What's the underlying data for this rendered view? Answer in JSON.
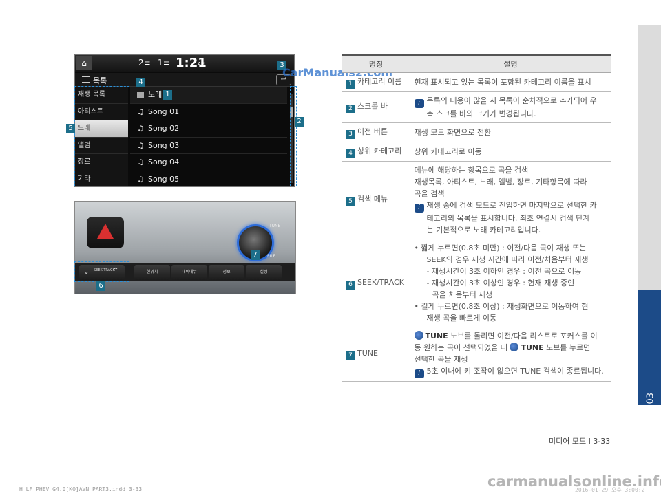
{
  "screen": {
    "stat_a": "2≡",
    "stat_b": "1≡",
    "clock": "1:21",
    "ampm": "AM",
    "title": "목록",
    "back": "↩",
    "categories": [
      "재생 목록",
      "아티스트",
      "노래",
      "앨범",
      "장르",
      "기타"
    ],
    "folder": "노래",
    "songs": [
      "Song 01",
      "Song 02",
      "Song 03",
      "Song 04",
      "Song 05"
    ]
  },
  "panel": {
    "tune": "TUNE",
    "file": "FILE",
    "seek": "SEEK TRACK",
    "buttons": [
      "현위치",
      "내비메뉴",
      "정보",
      "설정"
    ]
  },
  "badges": [
    "1",
    "2",
    "3",
    "4",
    "5",
    "6",
    "7"
  ],
  "table": {
    "header_name": "명칭",
    "header_desc": "설명",
    "rows": [
      {
        "num": "1",
        "name": "카테고리 이름",
        "desc": [
          "현재 표시되고 있는 목록이 포함된 카테고리 이름을 표시"
        ]
      },
      {
        "num": "2",
        "name": "스크롤 바",
        "desc": [
          "목록의 내용이 많을 시 목록이 순차적으로 추가되어 우",
          "측 스크롤 바의 크기가 변경됩니다."
        ]
      },
      {
        "num": "3",
        "name": "이전 버튼",
        "desc": [
          "재생 모드 화면으로 전환"
        ]
      },
      {
        "num": "4",
        "name": "상위 카테고리",
        "desc": [
          "상위 카테고리로 이동"
        ]
      },
      {
        "num": "5",
        "name": "검색 메뉴",
        "desc": [
          "메뉴에 해당하는 항목으로 곡을 검색",
          "재생목록, 아티스트, 노래, 앨범, 장르, 기타항목에 따라",
          "곡을 검색",
          "재생 중에 검색 모드로 진입하면 마지막으로 선택한 카",
          "테고리의 목록을 표시합니다. 최초 연결시 검색 단계",
          "는 기본적으로 노래 카테고리입니다."
        ]
      },
      {
        "num": "6",
        "name": "SEEK/TRACK",
        "desc": [
          "• 짧게 누르면(0.8초 미만) : 이전/다음 곡이 재생 또는",
          "SEEK의 경우 재생 시간에 따라 이전/처음부터 재생",
          "- 재생시간이 3초 이하인 경우 : 이전 곡으로 이동",
          "- 재생시간이 3초 이상인 경우 : 현재 재생 중인",
          "곡을 처음부터 재생",
          "• 길게 누르면(0.8초 이상) : 재생화면으로 이동하여 현",
          "재생 곡을 빠르게 이동"
        ]
      },
      {
        "num": "7",
        "name": "TUNE",
        "desc": [
          "TUNE",
          " 노브를 돌리면 이전/다음 리스트로 포커스를 이",
          "동 원하는 곡이 선택되었을 때 ",
          "TUNE",
          " 노브를 누르면",
          "선택한 곡을 재생",
          "5초 이내에 키 조작이 없으면 TUNE 검색이 종료됩니다."
        ]
      }
    ]
  },
  "info_icon": "i",
  "footer": {
    "page": "미디어 모드 I 3-33",
    "imprint": "H_LF PHEV_G4.0[KO]AVN_PART3.indd  3-33",
    "imprint_right": "2016-01-29  오후 3:00:2",
    "chapter": "03"
  },
  "watermarks": {
    "top": "CarManuals2.com",
    "bottom": "carmanualsonline.info"
  },
  "colors": {
    "accent_blue": "#1c4b88",
    "badge_teal": "#1c6e8a",
    "hazard_red": "#d93030",
    "knob_ring": "#2d6cd9"
  }
}
